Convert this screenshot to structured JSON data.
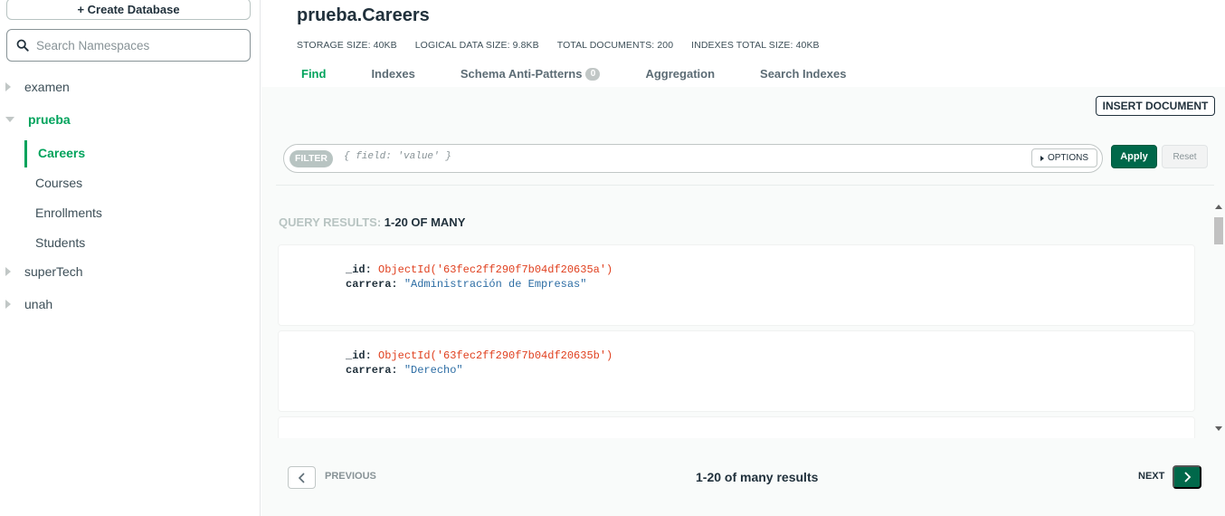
{
  "sidebar": {
    "create_database_label": "+ Create Database",
    "search_placeholder": "Search Namespaces",
    "databases": [
      {
        "name": "examen"
      },
      {
        "name": "prueba",
        "collections": [
          "Careers",
          "Courses",
          "Enrollments",
          "Students"
        ]
      },
      {
        "name": "superTech"
      },
      {
        "name": "unah"
      }
    ]
  },
  "header": {
    "namespace_title": "prueba.Careers",
    "stats": {
      "storage_size": "STORAGE SIZE: 40KB",
      "logical_data_size": "LOGICAL DATA SIZE: 9.8KB",
      "total_documents": "TOTAL DOCUMENTS: 200",
      "indexes_total_size": "INDEXES TOTAL SIZE: 40KB"
    },
    "tabs": [
      {
        "label": "Find"
      },
      {
        "label": "Indexes"
      },
      {
        "label": "Schema Anti-Patterns",
        "badge": "0"
      },
      {
        "label": "Aggregation"
      },
      {
        "label": "Search Indexes"
      }
    ]
  },
  "toolbar": {
    "insert_document_label": "INSERT DOCUMENT",
    "filter_label": "FILTER",
    "filter_placeholder": "{ field: 'value' }",
    "options_label": "OPTIONS",
    "apply_label": "Apply",
    "reset_label": "Reset"
  },
  "results": {
    "title_prefix": "QUERY RESULTS:",
    "title_range": "1-20 OF MANY",
    "documents": [
      {
        "id_key": "_id:",
        "id_value": "ObjectId('63fec2ff290f7b04df20635a')",
        "field_key": "carrera:",
        "field_value": "\"Administración de Empresas\""
      },
      {
        "id_key": "_id:",
        "id_value": "ObjectId('63fec2ff290f7b04df20635b')",
        "field_key": "carrera:",
        "field_value": "\"Derecho\""
      }
    ]
  },
  "pagination": {
    "previous_label": "PREVIOUS",
    "summary": "1-20 of many results",
    "next_label": "NEXT"
  },
  "colors": {
    "accent_green": "#00a35c",
    "button_green": "#00684a",
    "objectid_red": "#e0401f",
    "string_blue": "#2d6da4"
  }
}
